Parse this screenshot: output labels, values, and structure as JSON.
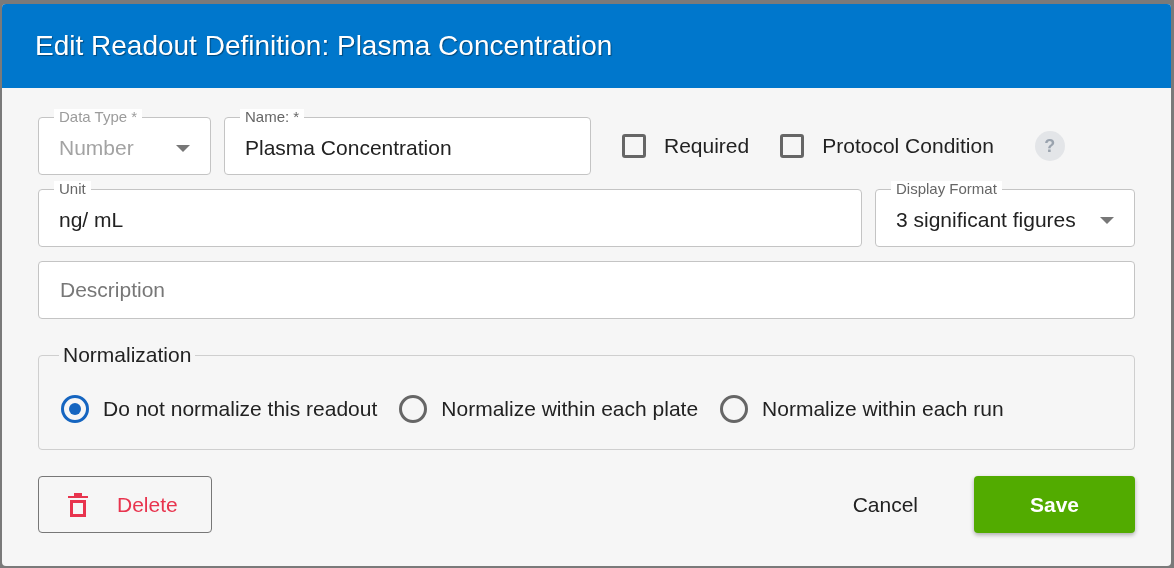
{
  "dialog": {
    "title": "Edit Readout Definition: Plasma Concentration"
  },
  "data_type": {
    "label": "Data Type *",
    "value": "Number",
    "disabled": true
  },
  "name": {
    "label": "Name: *",
    "value": "Plasma Concentration"
  },
  "checkboxes": [
    {
      "label": "Required",
      "checked": false
    },
    {
      "label": "Protocol Condition",
      "checked": false
    }
  ],
  "help": {
    "text": "?"
  },
  "unit": {
    "label": "Unit",
    "value": "ng/ mL"
  },
  "display_format": {
    "label": "Display Format",
    "value": "3 significant figures"
  },
  "description": {
    "placeholder": "Description"
  },
  "normalization": {
    "legend": "Normalization",
    "options": [
      {
        "label": "Do not normalize this readout",
        "selected": true
      },
      {
        "label": "Normalize within each plate",
        "selected": false
      },
      {
        "label": "Normalize within each run",
        "selected": false
      }
    ]
  },
  "buttons": {
    "delete": "Delete",
    "cancel": "Cancel",
    "save": "Save"
  }
}
